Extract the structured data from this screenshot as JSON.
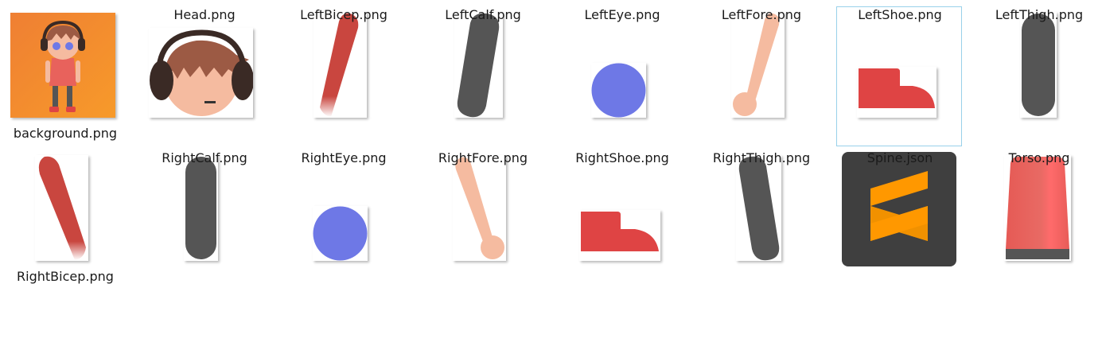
{
  "files": [
    {
      "name": "background.png",
      "icon": "background-thumbnail"
    },
    {
      "name": "Head.png",
      "icon": "head-thumbnail"
    },
    {
      "name": "LeftBicep.png",
      "icon": "left-bicep-thumbnail"
    },
    {
      "name": "LeftCalf.png",
      "icon": "left-calf-thumbnail"
    },
    {
      "name": "LeftEye.png",
      "icon": "left-eye-thumbnail"
    },
    {
      "name": "LeftFore.png",
      "icon": "left-fore-thumbnail"
    },
    {
      "name": "LeftShoe.png",
      "icon": "left-shoe-thumbnail",
      "selected": true
    },
    {
      "name": "LeftThigh.png",
      "icon": "left-thigh-thumbnail"
    },
    {
      "name": "RightBicep.png",
      "icon": "right-bicep-thumbnail"
    },
    {
      "name": "RightCalf.png",
      "icon": "right-calf-thumbnail"
    },
    {
      "name": "RightEye.png",
      "icon": "right-eye-thumbnail"
    },
    {
      "name": "RightFore.png",
      "icon": "right-fore-thumbnail"
    },
    {
      "name": "RightShoe.png",
      "icon": "right-shoe-thumbnail"
    },
    {
      "name": "RightThigh.png",
      "icon": "right-thigh-thumbnail"
    },
    {
      "name": "Spine.json",
      "icon": "sublime-text-icon"
    },
    {
      "name": "Torso.png",
      "icon": "torso-thumbnail"
    }
  ],
  "colors": {
    "orange": "#f5902e",
    "skin": "#f5bba0",
    "hair": "#9c5a44",
    "dark": "#555555",
    "red": "#c9463f",
    "shoe": "#df4444",
    "eye": "#6e78e6",
    "sublime_bg": "#3f3f3f",
    "sublime_logo": "#ff9800",
    "selection": "#99d1ea"
  }
}
